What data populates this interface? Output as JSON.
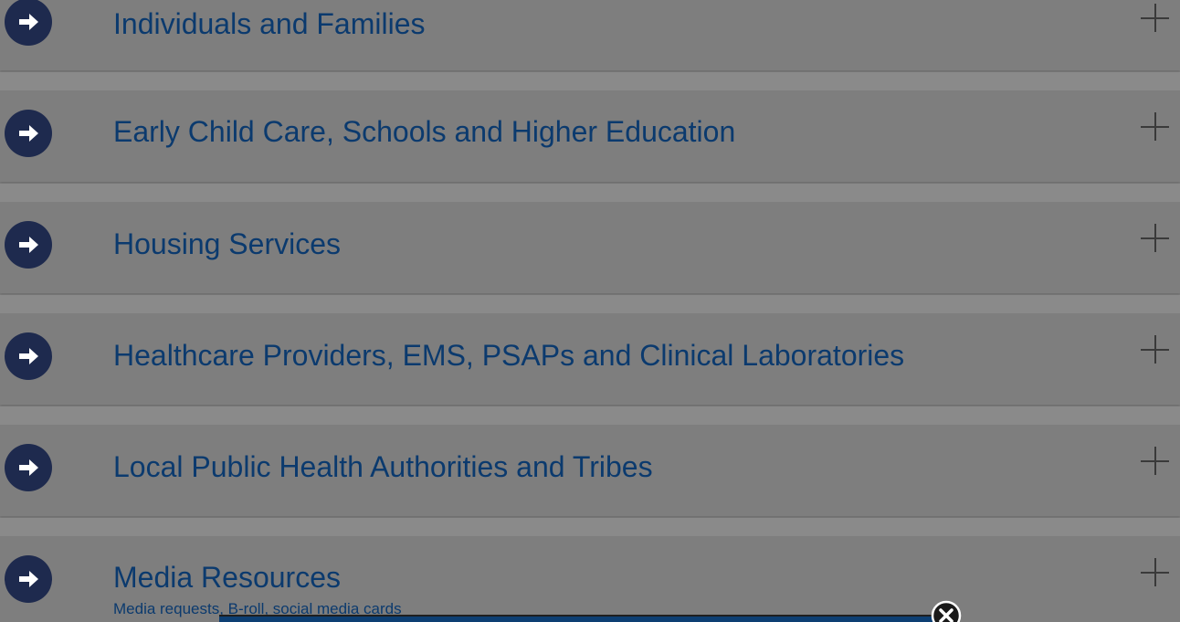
{
  "accordion": {
    "items": [
      {
        "title": "Individuals and Families"
      },
      {
        "title": "Early Child Care, Schools and Higher Education"
      },
      {
        "title": "Housing Services"
      },
      {
        "title": "Healthcare Providers, EMS, PSAPs and Clinical Laboratories"
      },
      {
        "title": "Local Public Health Authorities and Tribes"
      },
      {
        "title": "Media Resources",
        "subtitle": "Media requests, B-roll, social media cards"
      }
    ]
  },
  "icons": {
    "arrow": "arrow-right-circle-icon",
    "expand": "plus-icon",
    "close": "close-icon"
  },
  "colors": {
    "title_text": "#0b3a6e",
    "arrow_circle": "#1e2a4e",
    "overlay": "#7f7f7f",
    "modal_header": "#0d3f73"
  }
}
